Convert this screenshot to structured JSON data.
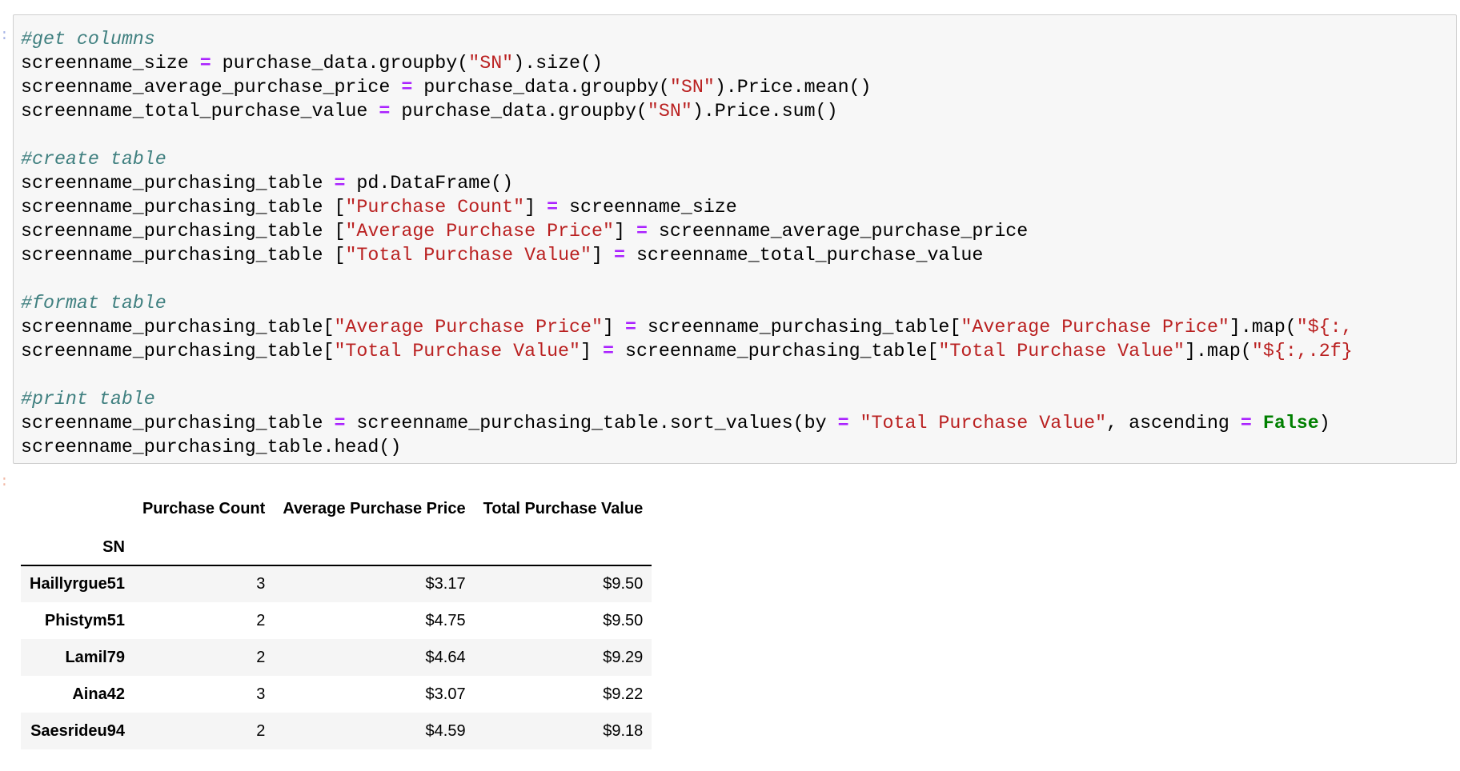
{
  "notebook": {
    "input_prompt": ":",
    "output_prompt": ":",
    "code_cell": {
      "lines": [
        [
          {
            "t": "comment",
            "v": "#get columns"
          }
        ],
        [
          {
            "t": "plain",
            "v": "screenname_size "
          },
          {
            "t": "op",
            "v": "="
          },
          {
            "t": "plain",
            "v": " purchase_data.groupby("
          },
          {
            "t": "str",
            "v": "\"SN\""
          },
          {
            "t": "plain",
            "v": ").size()"
          }
        ],
        [
          {
            "t": "plain",
            "v": "screenname_average_purchase_price "
          },
          {
            "t": "op",
            "v": "="
          },
          {
            "t": "plain",
            "v": " purchase_data.groupby("
          },
          {
            "t": "str",
            "v": "\"SN\""
          },
          {
            "t": "plain",
            "v": ").Price.mean()"
          }
        ],
        [
          {
            "t": "plain",
            "v": "screenname_total_purchase_value "
          },
          {
            "t": "op",
            "v": "="
          },
          {
            "t": "plain",
            "v": " purchase_data.groupby("
          },
          {
            "t": "str",
            "v": "\"SN\""
          },
          {
            "t": "plain",
            "v": ").Price.sum()"
          }
        ],
        [
          {
            "t": "plain",
            "v": ""
          }
        ],
        [
          {
            "t": "comment",
            "v": "#create table"
          }
        ],
        [
          {
            "t": "plain",
            "v": "screenname_purchasing_table "
          },
          {
            "t": "op",
            "v": "="
          },
          {
            "t": "plain",
            "v": " pd.DataFrame()"
          }
        ],
        [
          {
            "t": "plain",
            "v": "screenname_purchasing_table ["
          },
          {
            "t": "str",
            "v": "\"Purchase Count\""
          },
          {
            "t": "plain",
            "v": "] "
          },
          {
            "t": "op",
            "v": "="
          },
          {
            "t": "plain",
            "v": " screenname_size"
          }
        ],
        [
          {
            "t": "plain",
            "v": "screenname_purchasing_table ["
          },
          {
            "t": "str",
            "v": "\"Average Purchase Price\""
          },
          {
            "t": "plain",
            "v": "] "
          },
          {
            "t": "op",
            "v": "="
          },
          {
            "t": "plain",
            "v": " screenname_average_purchase_price"
          }
        ],
        [
          {
            "t": "plain",
            "v": "screenname_purchasing_table ["
          },
          {
            "t": "str",
            "v": "\"Total Purchase Value\""
          },
          {
            "t": "plain",
            "v": "] "
          },
          {
            "t": "op",
            "v": "="
          },
          {
            "t": "plain",
            "v": " screenname_total_purchase_value"
          }
        ],
        [
          {
            "t": "plain",
            "v": ""
          }
        ],
        [
          {
            "t": "comment",
            "v": "#format table"
          }
        ],
        [
          {
            "t": "plain",
            "v": "screenname_purchasing_table["
          },
          {
            "t": "str",
            "v": "\"Average Purchase Price\""
          },
          {
            "t": "plain",
            "v": "] "
          },
          {
            "t": "op",
            "v": "="
          },
          {
            "t": "plain",
            "v": " screenname_purchasing_table["
          },
          {
            "t": "str",
            "v": "\"Average Purchase Price\""
          },
          {
            "t": "plain",
            "v": "].map("
          },
          {
            "t": "str",
            "v": "\"${:,"
          }
        ],
        [
          {
            "t": "plain",
            "v": "screenname_purchasing_table["
          },
          {
            "t": "str",
            "v": "\"Total Purchase Value\""
          },
          {
            "t": "plain",
            "v": "] "
          },
          {
            "t": "op",
            "v": "="
          },
          {
            "t": "plain",
            "v": " screenname_purchasing_table["
          },
          {
            "t": "str",
            "v": "\"Total Purchase Value\""
          },
          {
            "t": "plain",
            "v": "].map("
          },
          {
            "t": "str",
            "v": "\"${:,.2f}"
          }
        ],
        [
          {
            "t": "plain",
            "v": ""
          }
        ],
        [
          {
            "t": "comment",
            "v": "#print table"
          }
        ],
        [
          {
            "t": "plain",
            "v": "screenname_purchasing_table "
          },
          {
            "t": "op",
            "v": "="
          },
          {
            "t": "plain",
            "v": " screenname_purchasing_table.sort_values(by "
          },
          {
            "t": "op",
            "v": "="
          },
          {
            "t": "plain",
            "v": " "
          },
          {
            "t": "str",
            "v": "\"Total Purchase Value\""
          },
          {
            "t": "plain",
            "v": ", ascending "
          },
          {
            "t": "op",
            "v": "="
          },
          {
            "t": "plain",
            "v": " "
          },
          {
            "t": "kw",
            "v": "False"
          },
          {
            "t": "plain",
            "v": ")"
          }
        ],
        [
          {
            "t": "plain",
            "v": "screenname_purchasing_table.head()"
          }
        ]
      ]
    },
    "output_table": {
      "columns": [
        "Purchase Count",
        "Average Purchase Price",
        "Total Purchase Value"
      ],
      "index_name": "SN",
      "rows": [
        {
          "index": "Haillyrgue51",
          "values": [
            "3",
            "$3.17",
            "$9.50"
          ]
        },
        {
          "index": "Phistym51",
          "values": [
            "2",
            "$4.75",
            "$9.50"
          ]
        },
        {
          "index": "Lamil79",
          "values": [
            "2",
            "$4.64",
            "$9.29"
          ]
        },
        {
          "index": "Aina42",
          "values": [
            "3",
            "$3.07",
            "$9.22"
          ]
        },
        {
          "index": "Saesrideu94",
          "values": [
            "2",
            "$4.59",
            "$9.18"
          ]
        }
      ]
    }
  },
  "colors": {
    "comment": "#408080",
    "operator": "#aa22ff",
    "string": "#ba2121",
    "keyword": "#008000",
    "cell_background": "#f7f7f7",
    "row_stripe": "#f5f5f5"
  }
}
